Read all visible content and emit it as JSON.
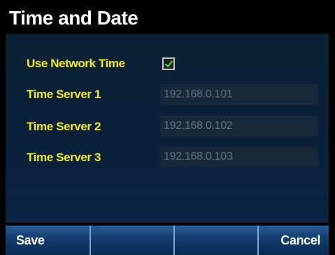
{
  "title": "Time and Date",
  "form": {
    "use_network_time": {
      "label": "Use Network Time",
      "checked": true,
      "check_color": "#3cc83c"
    },
    "servers": [
      {
        "label": "Time Server 1",
        "value": "192.168.0.101"
      },
      {
        "label": "Time Server 2",
        "value": "192.168.0.102"
      },
      {
        "label": "Time Server 3",
        "value": "192.168.0.103"
      }
    ]
  },
  "softkeys": {
    "save": "Save",
    "cancel": "Cancel"
  },
  "colors": {
    "label": "#f2ea1c",
    "background": "#0a2038",
    "softkey_bar": "#123e70",
    "field_text": "#65707c"
  }
}
